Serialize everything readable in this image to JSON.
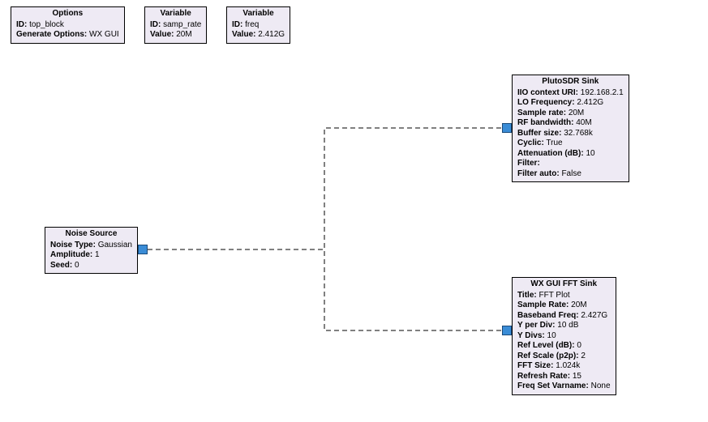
{
  "blocks": {
    "options": {
      "title": "Options",
      "params": [
        {
          "k": "ID:",
          "v": "top_block"
        },
        {
          "k": "Generate Options:",
          "v": "WX GUI"
        }
      ]
    },
    "var1": {
      "title": "Variable",
      "params": [
        {
          "k": "ID:",
          "v": "samp_rate"
        },
        {
          "k": "Value:",
          "v": "20M"
        }
      ]
    },
    "var2": {
      "title": "Variable",
      "params": [
        {
          "k": "ID:",
          "v": "freq"
        },
        {
          "k": "Value:",
          "v": "2.412G"
        }
      ]
    },
    "noise": {
      "title": "Noise Source",
      "params": [
        {
          "k": "Noise Type:",
          "v": "Gaussian"
        },
        {
          "k": "Amplitude:",
          "v": "1"
        },
        {
          "k": "Seed:",
          "v": "0"
        }
      ]
    },
    "pluto": {
      "title": "PlutoSDR Sink",
      "params": [
        {
          "k": "IIO context URI:",
          "v": "192.168.2.1"
        },
        {
          "k": "LO Frequency:",
          "v": "2.412G"
        },
        {
          "k": "Sample rate:",
          "v": "20M"
        },
        {
          "k": "RF bandwidth:",
          "v": "40M"
        },
        {
          "k": "Buffer size:",
          "v": "32.768k"
        },
        {
          "k": "Cyclic:",
          "v": "True"
        },
        {
          "k": "Attenuation (dB):",
          "v": "10"
        },
        {
          "k": "Filter:",
          "v": ""
        },
        {
          "k": "Filter auto:",
          "v": "False"
        }
      ]
    },
    "fft": {
      "title": "WX GUI FFT Sink",
      "params": [
        {
          "k": "Title:",
          "v": "FFT Plot"
        },
        {
          "k": "Sample Rate:",
          "v": "20M"
        },
        {
          "k": "Baseband Freq:",
          "v": "2.427G"
        },
        {
          "k": "Y per Div:",
          "v": "10 dB"
        },
        {
          "k": "Y Divs:",
          "v": "10"
        },
        {
          "k": "Ref Level (dB):",
          "v": "0"
        },
        {
          "k": "Ref Scale (p2p):",
          "v": "2"
        },
        {
          "k": "FFT Size:",
          "v": "1.024k"
        },
        {
          "k": "Refresh Rate:",
          "v": "15"
        },
        {
          "k": "Freq Set Varname:",
          "v": "None"
        }
      ]
    }
  },
  "colors": {
    "block_bg": "#eeeaf4",
    "port": "#3a8cd6"
  }
}
